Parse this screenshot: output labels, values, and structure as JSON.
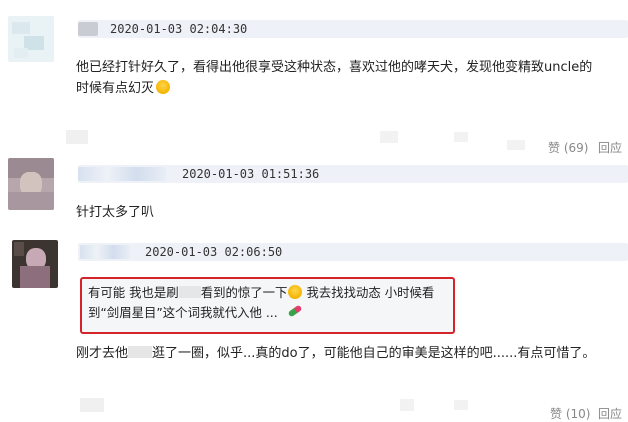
{
  "comments": [
    {
      "time": "2020-01-03 02:04:30",
      "text_line1": "他已经打针好久了，看得出他很享受这种状态，喜欢过他的哮天犬，发现他变精致uncle的",
      "text_line2": "时候有点幻灭",
      "emoji": "laugh-emoji",
      "likes": "赞 (69)",
      "reply": "回应"
    },
    {
      "time": "2020-01-03 01:51:36",
      "text": "针打太多了叭"
    },
    {
      "time": "2020-01-03 02:06:50",
      "quote_line1_a": "有可能 我也是刷",
      "quote_line1_b": "看到的惊了一下",
      "quote_line1_c": "我去找找动态 小时候看",
      "quote_line2": "到“剑眉星目”这个词我就代入他 ...",
      "reply_text_a": "刚才去他",
      "reply_text_b": "逛了一圈，似乎...真的do了，可能他自己的审美是这样的吧......有点可惜了。",
      "likes": "赞 (10)",
      "reply": "回应"
    }
  ],
  "colors": {
    "highlight_border": "#d4242a",
    "name_blue": "#d7e1ef",
    "meta_bg": "#eef2f8"
  }
}
